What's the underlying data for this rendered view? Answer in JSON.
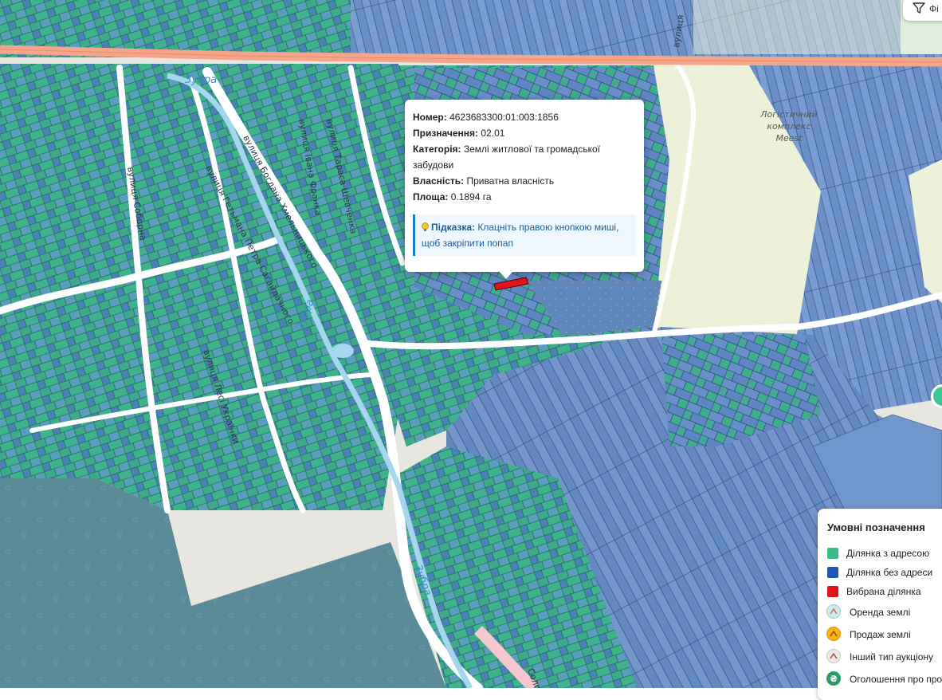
{
  "map": {
    "streets": [
      {
        "id": "zubra-top",
        "text": "Зубра"
      },
      {
        "id": "khmelnytskoho",
        "text": "вулиця Богдана Хмельницького"
      },
      {
        "id": "sahaidachnoho",
        "text": "вулиця Гетьмана Петра Сагайдачного"
      },
      {
        "id": "ivana-franka",
        "text": "вулиця Івана Франка"
      },
      {
        "id": "shevchenka",
        "text": "вулиця Тараса Шевченка"
      },
      {
        "id": "vulytsia-right",
        "text": "вулиця"
      },
      {
        "id": "ukrainky",
        "text": "вулиця Лесі Українки"
      },
      {
        "id": "sobornosti",
        "text": "вулиця Соборна"
      },
      {
        "id": "zubra-mid",
        "text": "Зубра"
      },
      {
        "id": "zubra-low",
        "text": "Зубра"
      },
      {
        "id": "solo",
        "text": "Соло"
      }
    ],
    "poi": {
      "line1": "Логістичний",
      "line2": "комплекс",
      "line3": "Meest"
    },
    "colors": {
      "with_address": "#3dbb8d",
      "without_address": "#2456b8",
      "selected": "#e0141b"
    }
  },
  "popup": {
    "number_label": "Номер:",
    "number": "4623683300:01:003:1856",
    "purpose_label": "Призначення:",
    "purpose": "02.01",
    "category_label": "Категорія:",
    "category": "Землі житлової та громадської забудови",
    "ownership_label": "Власність:",
    "ownership": "Приватна власність",
    "area_label": "Площа:",
    "area": "0.1894 га",
    "hint_label": "Підказка:",
    "hint": "Клацніть правою кнопкою миші, щоб закріпити попап"
  },
  "filter": {
    "label": "Фі",
    "icon": "filter-icon"
  },
  "legend": {
    "title": "Умовні позначення",
    "items": [
      {
        "label": "Ділянка з адресою",
        "color": "#3dbb8d"
      },
      {
        "label": "Ділянка без адреси",
        "color": "#1f56b7"
      },
      {
        "label": "Вибрана ділянка",
        "color": "#e0141b"
      },
      {
        "label": "Оренда землі",
        "icon": "lease-icon"
      },
      {
        "label": "Продаж землі",
        "icon": "sale-icon"
      },
      {
        "label": "Інший тип аукціону",
        "icon": "auction-icon"
      },
      {
        "label": "Оголошення про про",
        "icon": "hryvnia-icon"
      }
    ]
  }
}
